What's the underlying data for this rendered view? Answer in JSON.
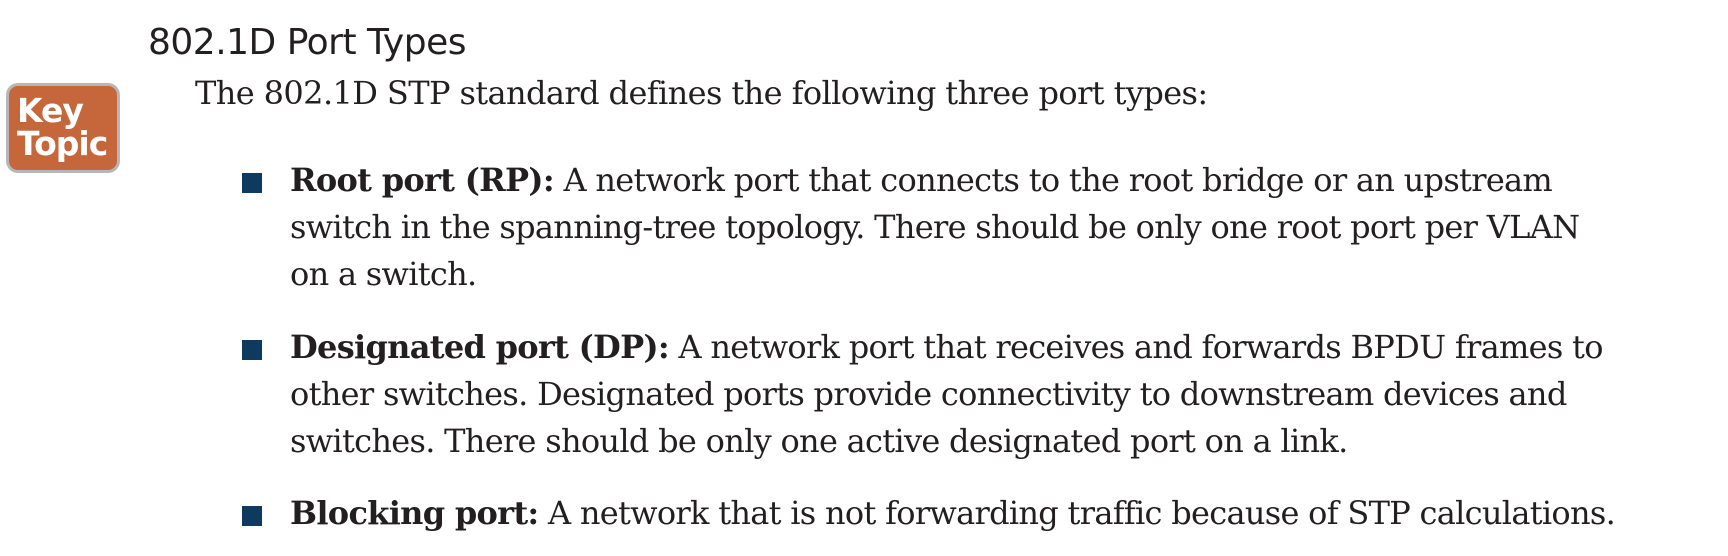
{
  "section": {
    "heading": "802.1D Port Types",
    "badge": [
      "Key",
      "Topic"
    ],
    "intro": "The 802.1D STP standard defines the following three port types:"
  },
  "items": [
    {
      "term": "Root port (RP):",
      "lines": [
        " A network port that connects to the root bridge or an upstream",
        "switch in the spanning-tree topology. There should be only one root port per VLAN",
        "on a switch."
      ]
    },
    {
      "term": "Designated port (DP):",
      "lines": [
        " A network port that receives and forwards BPDU frames to",
        "other switches. Designated ports provide connectivity to downstream devices and",
        "switches. There should be only one active designated port on a link."
      ]
    },
    {
      "term": "Blocking port:",
      "lines": [
        " A network that is not forwarding traffic because of STP calculations."
      ]
    }
  ],
  "colors": {
    "badge": "#c5673b",
    "bullet": "#0f3a5f"
  }
}
